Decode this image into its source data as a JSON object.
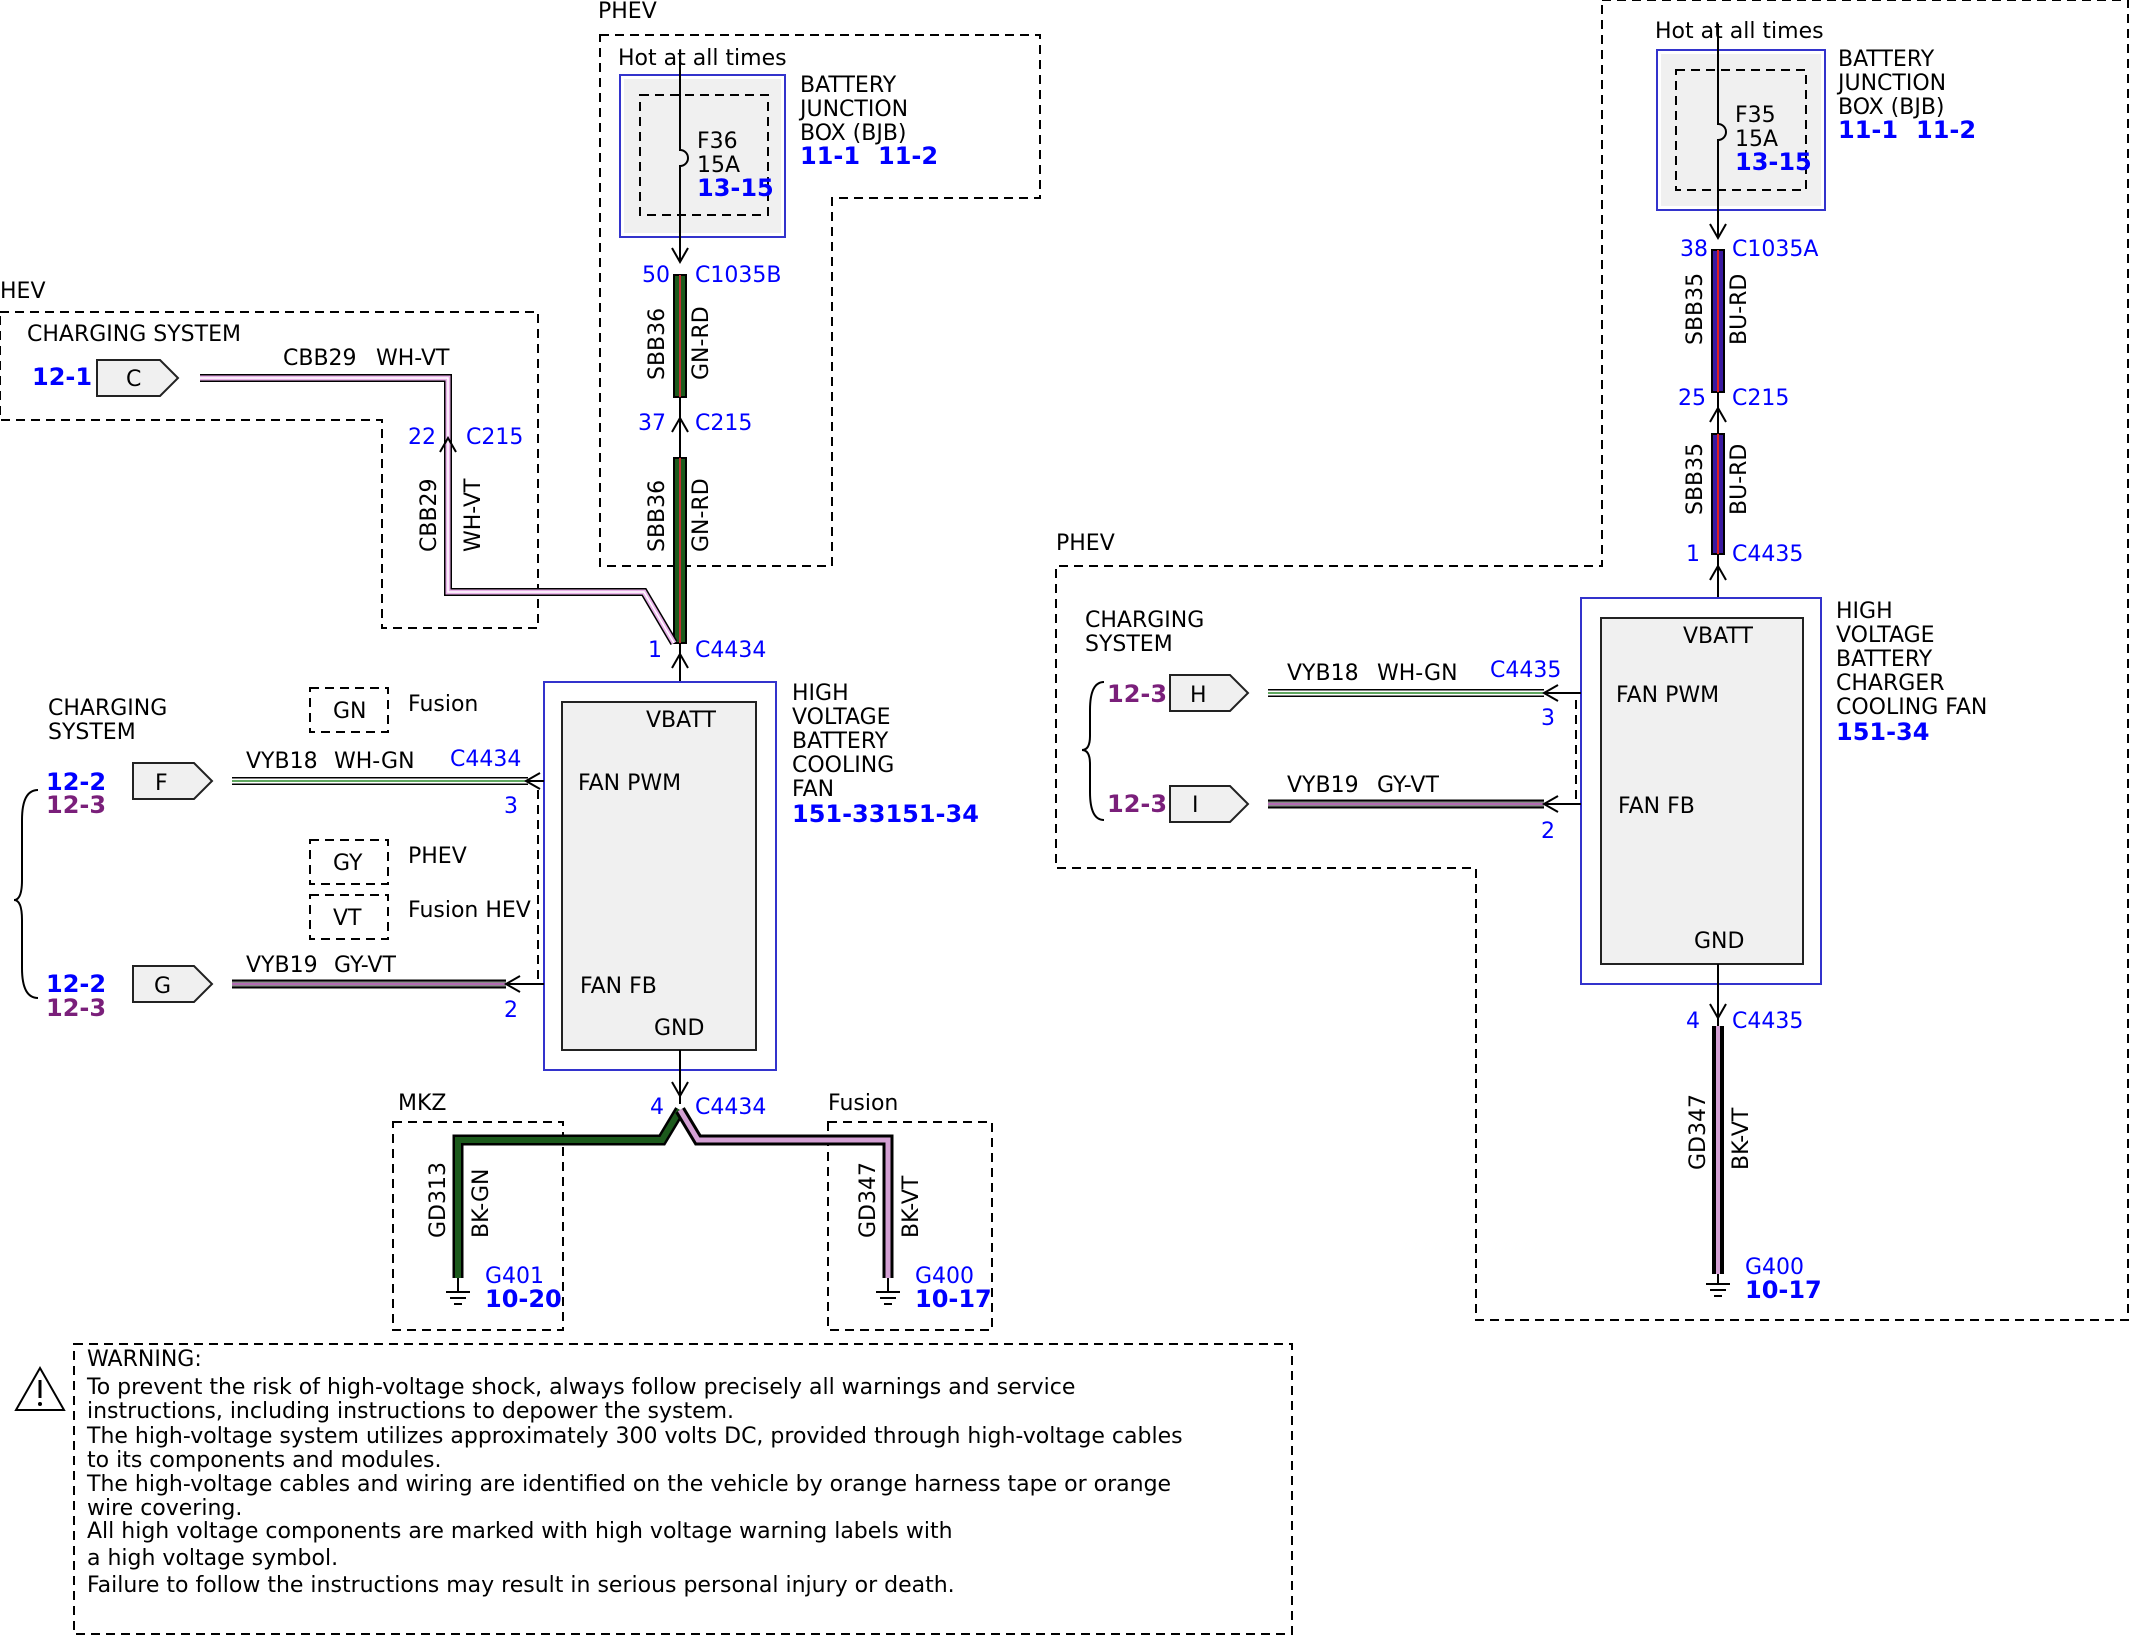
{
  "colors": {
    "ref_blue": "#0000ff",
    "ref_purple": "#7a1f7a",
    "box_blue": "#3333cc"
  },
  "groups": {
    "phev_left": "PHEV",
    "hev": "HEV",
    "phev_right": "PHEV",
    "mkz": "MKZ",
    "fusion": "Fusion"
  },
  "left": {
    "hot": "Hot at all times",
    "bjb": {
      "l1": "BATTERY",
      "l2": "JUNCTION",
      "l3": "BOX (BJB)",
      "ref1": "11-1",
      "ref2": "11-2"
    },
    "fuse": {
      "id": "F36",
      "amp": "15A",
      "ref": "13-15"
    },
    "pin50": "50",
    "c1035b": "C1035B",
    "sbb36a": "SBB36",
    "gnrd_a": "GN-RD",
    "pin37": "37",
    "c215a": "C215",
    "sbb36b": "SBB36",
    "gnrd_b": "GN-RD",
    "pin1": "1",
    "c4434a": "C4434",
    "cs_hev": "CHARGING SYSTEM",
    "ref121": "12-1",
    "conn_c": "C",
    "cbb29h": "CBB29",
    "whvt_h": "WH-VT",
    "pin22": "22",
    "c215b": "C215",
    "cbb29v": "CBB29",
    "whvt_v": "WH-VT",
    "cs2_l1": "CHARGING",
    "cs2_l2": "SYSTEM",
    "ref122a": "12-2",
    "ref123a": "12-3",
    "conn_f": "F",
    "vyb18": "VYB18",
    "whgn": "WH-GN",
    "c4434b": "C4434",
    "pin3": "3",
    "ref122b": "12-2",
    "ref123b": "12-3",
    "conn_g": "G",
    "vyb19": "VYB19",
    "gyvt": "GY-VT",
    "pin2": "2",
    "legend": [
      {
        "code": "GN",
        "label": "Fusion"
      },
      {
        "code": "GY",
        "label": "PHEV"
      },
      {
        "code": "VT",
        "label": "Fusion HEV"
      }
    ],
    "fan": {
      "l1": "HIGH",
      "l2": "VOLTAGE",
      "l3": "BATTERY",
      "l4": "COOLING",
      "l5": "FAN",
      "ref": "151-33151-34",
      "vbatt": "VBATT",
      "pwm": "FAN PWM",
      "fb": "FAN FB",
      "gnd": "GND"
    },
    "pin4": "4",
    "c4434c": "C4434",
    "gd313": "GD313",
    "bkgn": "BK-GN",
    "g401": "G401",
    "ref1020": "10-20",
    "gd347": "GD347",
    "bkvt": "BK-VT",
    "g400": "G400",
    "ref1017": "10-17"
  },
  "right": {
    "hot": "Hot at all times",
    "bjb": {
      "l1": "BATTERY",
      "l2": "JUNCTION",
      "l3": "BOX (BJB)",
      "ref1": "11-1",
      "ref2": "11-2"
    },
    "fuse": {
      "id": "F35",
      "amp": "15A",
      "ref": "13-15"
    },
    "pin38": "38",
    "c1035a": "C1035A",
    "sbb35a": "SBB35",
    "burd_a": "BU-RD",
    "pin25": "25",
    "c215": "C215",
    "sbb35b": "SBB35",
    "burd_b": "BU-RD",
    "pin1": "1",
    "c4435a": "C4435",
    "cs_l1": "CHARGING",
    "cs_l2": "SYSTEM",
    "ref123a": "12-3",
    "conn_h": "H",
    "vyb18": "VYB18",
    "whgn": "WH-GN",
    "c4435b": "C4435",
    "pin3": "3",
    "ref123b": "12-3",
    "conn_i": "I",
    "vyb19": "VYB19",
    "gyvt": "GY-VT",
    "pin2": "2",
    "fan": {
      "l1": "HIGH",
      "l2": "VOLTAGE",
      "l3": "BATTERY",
      "l4": "CHARGER",
      "l5": "COOLING FAN",
      "ref": "151-34",
      "vbatt": "VBATT",
      "pwm": "FAN PWM",
      "fb": "FAN FB",
      "gnd": "GND"
    },
    "pin4": "4",
    "c4435c": "C4435",
    "gd347": "GD347",
    "bkvt": "BK-VT",
    "g400": "G400",
    "ref1017": "10-17"
  },
  "warning": {
    "title": "WARNING:",
    "lines": [
      "To prevent the risk of high-voltage shock, always follow precisely all warnings and service",
      "instructions, including instructions to depower the system.",
      "The high-voltage system utilizes approximately 300 volts DC, provided through high-voltage cables",
      "to its components and modules.",
      "The high-voltage cables and wiring are identified on the vehicle by orange harness tape or orange",
      "wire covering.",
      "All high voltage components are marked with high voltage warning labels with",
      "a high voltage symbol.",
      "Failure to follow the instructions may result in serious personal injury or death."
    ]
  }
}
